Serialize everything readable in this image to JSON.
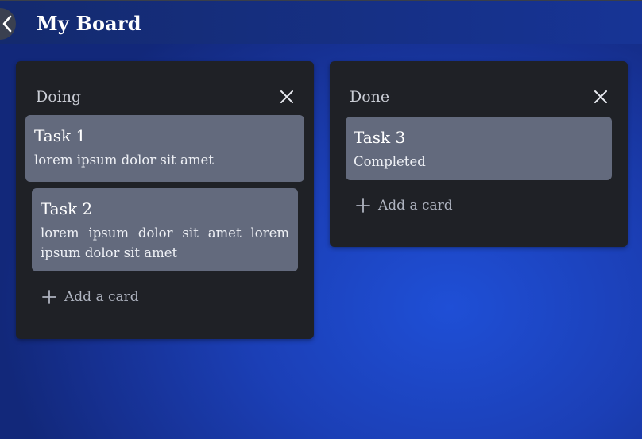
{
  "header": {
    "title": "My Board",
    "back_icon": "chevron-left-icon"
  },
  "lists": [
    {
      "title": "Doing",
      "close_icon": "close-icon",
      "cards": [
        {
          "title": "Task 1",
          "description": "lorem ipsum dolor sit amet"
        },
        {
          "title": "Task 2",
          "description": "lorem ipsum dolor sit amet lorem ipsum dolor sit amet"
        }
      ],
      "add_label": "Add a card"
    },
    {
      "title": "Done",
      "close_icon": "close-icon",
      "cards": [
        {
          "title": "Task 3",
          "description": "Completed"
        }
      ],
      "add_label": "Add a card"
    }
  ],
  "colors": {
    "background": "#1b3fb6",
    "topbar": "#142a6e",
    "list_bg": "#1f2126",
    "card_bg": "#636a7d",
    "muted_text": "#aeb3bf"
  }
}
